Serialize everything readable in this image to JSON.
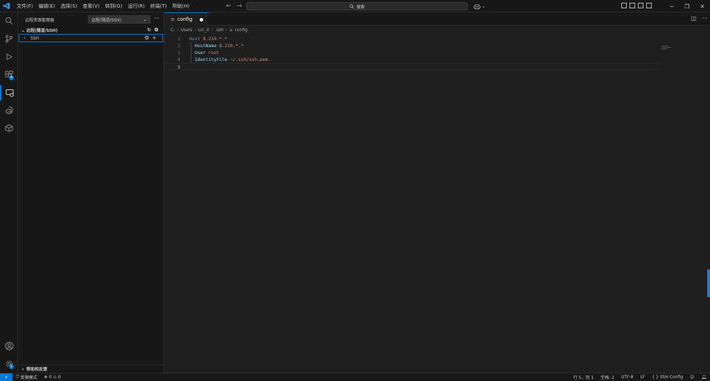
{
  "menu": [
    "文件(F)",
    "编辑(E)",
    "选择(S)",
    "查看(V)",
    "转到(G)",
    "运行(R)",
    "终端(T)",
    "帮助(H)"
  ],
  "search": {
    "placeholder": "搜索"
  },
  "activity": {
    "extensions_badge": "4",
    "accounts_badge": "1"
  },
  "sidebar": {
    "title": "远程资源管理器",
    "select_value": "远程(隧道/SSH)",
    "section_title": "远程(隧道/SSH)",
    "tree_item": "SSH",
    "footer_section": "帮助和反馈"
  },
  "editor": {
    "tab_label": "config",
    "breadcrumb": [
      "C:",
      "Users",
      "Lin_X",
      ".ssh",
      "config"
    ],
    "lines": [
      {
        "n": "1",
        "k": "Host",
        "v": "8.210.*.*"
      },
      {
        "n": "2",
        "k": "HostName",
        "v": "8.210.*.*"
      },
      {
        "n": "3",
        "k": "User",
        "v": "root"
      },
      {
        "n": "4",
        "k": "IdentityFile",
        "v": "~/.ssh/ssh.pem"
      },
      {
        "n": "5",
        "k": "",
        "v": ""
      }
    ]
  },
  "status": {
    "restricted_mode": "受限模式",
    "errors": "0",
    "warnings": "0",
    "position": "行 5，列 1",
    "spaces": "空格: 2",
    "encoding": "UTF-8",
    "eol": "LF",
    "language": "SSH Config"
  },
  "colors": {
    "accent": "#0078d4",
    "keyword": "#569cd6",
    "key": "#9cdcfe",
    "value": "#ce9178"
  }
}
